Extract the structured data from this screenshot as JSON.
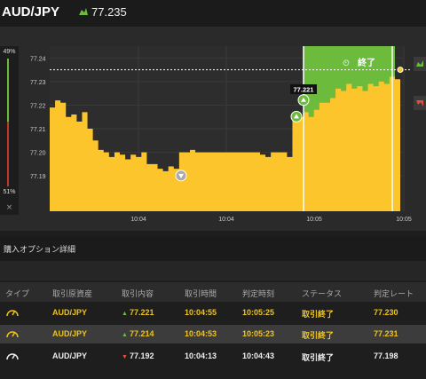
{
  "header": {
    "pair": "AUD/JPY",
    "price": "77.235",
    "price_icon": "rising-arrow-icon"
  },
  "meter": {
    "top_percent": "49%",
    "bottom_percent": "51%",
    "close_label": "×",
    "colors": {
      "up": "#6dbb3c",
      "down": "#c0392b"
    }
  },
  "chart": {
    "current_label": "77.221",
    "expiry_button_label": "終了",
    "colors": {
      "area": "#fcc52b",
      "window": "#6dbb3c"
    }
  },
  "chart_data": {
    "type": "area",
    "title": "",
    "xlabel": "",
    "ylabel": "",
    "ylim": [
      77.175,
      77.25
    ],
    "y_ticks": [
      "77.24",
      "77.23",
      "77.22",
      "77.21",
      "77.20",
      "77.19"
    ],
    "x_ticks": [
      "10:04",
      "10:04",
      "10:05",
      "10:05"
    ],
    "current_price": 77.235,
    "series": [
      {
        "values": [
          77.219,
          77.222,
          77.221,
          77.215,
          77.216,
          77.213,
          77.217,
          77.21,
          77.205,
          77.201,
          77.2,
          77.198,
          77.2,
          77.199,
          77.197,
          77.199,
          77.198,
          77.2,
          77.195,
          77.195,
          77.193,
          77.192,
          77.194,
          77.193,
          77.2,
          77.2,
          77.201,
          77.2,
          77.2,
          77.2,
          77.2,
          77.2,
          77.2,
          77.2,
          77.2,
          77.2,
          77.2,
          77.2,
          77.2,
          77.199,
          77.198,
          77.2,
          77.2,
          77.2,
          77.198,
          77.215,
          77.215,
          77.217,
          77.215,
          77.218,
          77.221,
          77.221,
          77.223,
          77.227,
          77.226,
          77.229,
          77.227,
          77.228,
          77.226,
          77.229,
          77.228,
          77.23,
          77.229,
          77.232,
          77.231,
          77.235
        ]
      }
    ],
    "markers": [
      {
        "price": 77.192,
        "direction": "down"
      },
      {
        "price": 77.214,
        "direction": "up"
      },
      {
        "price": 77.221,
        "direction": "up"
      }
    ]
  },
  "details": {
    "title": "購入オプション詳細",
    "columns": [
      "タイプ",
      "取引原資産",
      "取引内容",
      "取引時間",
      "判定時刻",
      "ステータス",
      "判定レート"
    ],
    "rows": [
      {
        "asset": "AUD/JPY",
        "direction": "up",
        "rate": "77.221",
        "time": "10:04:55",
        "expiry": "10:05:25",
        "status": "取引終了",
        "result": "77.230",
        "type_icon": "gauge-icon"
      },
      {
        "asset": "AUD/JPY",
        "direction": "up",
        "rate": "77.214",
        "time": "10:04:53",
        "expiry": "10:05:23",
        "status": "取引終了",
        "result": "77.231",
        "type_icon": "gauge-icon"
      },
      {
        "asset": "AUD/JPY",
        "direction": "down",
        "rate": "77.192",
        "time": "10:04:13",
        "expiry": "10:04:43",
        "status": "取引終了",
        "result": "77.198",
        "type_icon": "gauge-icon"
      }
    ]
  }
}
